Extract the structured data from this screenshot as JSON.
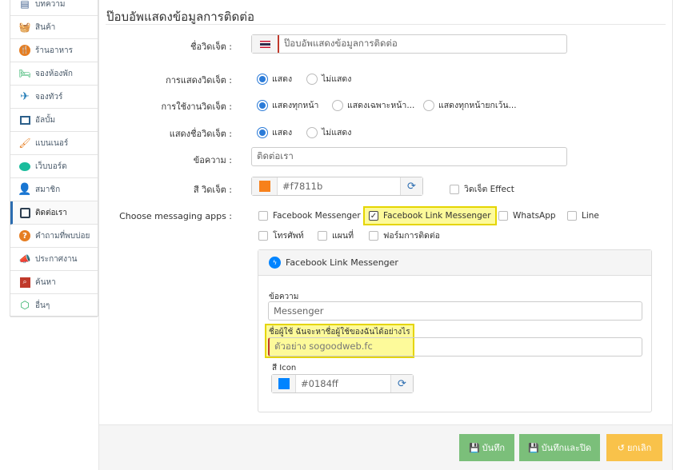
{
  "sidebar": {
    "items": [
      {
        "label": "บทความ",
        "icon": "article-icon",
        "color": "#3b5b8a"
      },
      {
        "label": "สินค้า",
        "icon": "shopping-basket-icon",
        "color": "#c0392b"
      },
      {
        "label": "ร้านอาหาร",
        "icon": "restaurant-icon",
        "color": "#e67e22"
      },
      {
        "label": "จองห้องพัก",
        "icon": "bed-icon",
        "color": "#27ae60"
      },
      {
        "label": "จองทัวร์",
        "icon": "airplane-icon",
        "color": "#2980b9"
      },
      {
        "label": "อัลบั้ม",
        "icon": "photo-album-icon",
        "color": "#2c5f8a"
      },
      {
        "label": "แบนเนอร์",
        "icon": "brush-icon",
        "color": "#e67e22"
      },
      {
        "label": "เว็บบอร์ด",
        "icon": "chat-bubble-icon",
        "color": "#1abc9c"
      },
      {
        "label": "สมาชิก",
        "icon": "user-icon",
        "color": "#7b1f1f"
      },
      {
        "label": "ติดต่อเรา",
        "icon": "contact-card-icon",
        "color": "#2c3e50"
      },
      {
        "label": "คำถามที่พบบ่อย",
        "icon": "question-icon",
        "color": "#e67e22"
      },
      {
        "label": "ประกาศงาน",
        "icon": "megaphone-icon",
        "color": "#2c3e80"
      },
      {
        "label": "ค้นหา",
        "icon": "search-icon",
        "color": "#c0392b"
      },
      {
        "label": "อื่นๆ",
        "icon": "cube-icon",
        "color": "#27ae60"
      }
    ]
  },
  "page": {
    "title": "ป๊อบอัพแสดงข้อมูลการติดต่อ"
  },
  "form": {
    "widget_name": {
      "label": "ชื่อวิดเจ็ต :",
      "value": "ป๊อบอัพแสดงข้อมูลการติดต่อ"
    },
    "display": {
      "label": "การแสดงวิดเจ็ต :",
      "opt_show": "แสดง",
      "opt_hide": "ไม่แสดง"
    },
    "usage": {
      "label": "การใช้งานวิดเจ็ต :",
      "opt_all": "แสดงทุกหน้า",
      "opt_some": "แสดงเฉพาะหน้า...",
      "opt_except": "แสดงทุกหน้ายกเว้น..."
    },
    "show_name": {
      "label": "แสดงชื่อวิดเจ็ต :",
      "opt_show": "แสดง",
      "opt_hide": "ไม่แสดง"
    },
    "message": {
      "label": "ข้อความ :",
      "value": "ติดต่อเรา"
    },
    "color": {
      "label": "สี วิดเจ็ต :",
      "value": "#f7811b",
      "swatch": "#f7811b",
      "effect_label": "วิดเจ็ต Effect"
    },
    "apps": {
      "label": "Choose messaging apps :",
      "fb_messenger": "Facebook Messenger",
      "fb_link": "Facebook Link Messenger",
      "whatsapp": "WhatsApp",
      "line": "Line",
      "phone": "โทรศัพท์",
      "map": "แผนที่",
      "contact_form": "ฟอร์มการติดต่อ"
    }
  },
  "panel": {
    "title": "Facebook Link Messenger",
    "message_label": "ข้อความ",
    "message_value": "Messenger",
    "username_label": "ชื่อผู้ใช้ ฉันจะหาชื่อผู้ใช้ของฉันได้อย่างไร",
    "username_placeholder": "ตัวอย่าง sogoodweb.fc",
    "icon_color_label": "สี Icon",
    "icon_color_value": "#0184ff",
    "icon_swatch": "#0184ff"
  },
  "buttons": {
    "save": "บันทึก",
    "save_close": "บันทึกและปิด",
    "cancel": "ยกเลิก"
  },
  "colors": {
    "save_bg": "#7bbf7a",
    "cancel_bg": "#f9c24a",
    "highlight": "#fdfa9a",
    "highlight_border": "#e5d500",
    "radio_accent": "#2b7bd8"
  }
}
